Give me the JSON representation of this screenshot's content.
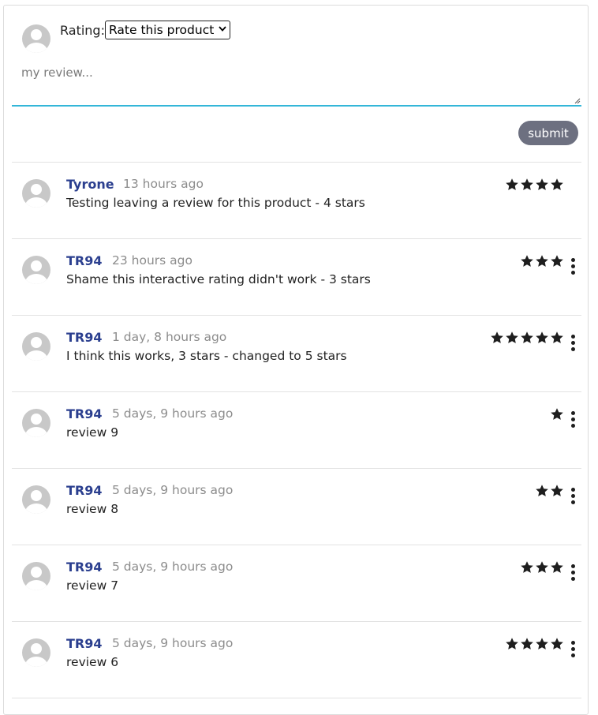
{
  "form": {
    "rating_label": "Rating:",
    "rating_select_value": "Rate this product",
    "review_placeholder": "my review...",
    "submit_label": "submit"
  },
  "colors": {
    "author": "#2b3f8f",
    "submit_bg": "#6d7080",
    "input_focus": "#33b6d8",
    "star": "#1e1e1e"
  },
  "reviews": [
    {
      "author": "Tyrone",
      "time": "13 hours ago",
      "text": "Testing leaving a review for this product - 4 stars",
      "stars": 4,
      "has_menu": false
    },
    {
      "author": "TR94",
      "time": "23 hours ago",
      "text": "Shame this interactive rating didn't work - 3 stars",
      "stars": 3,
      "has_menu": true
    },
    {
      "author": "TR94",
      "time": "1 day, 8 hours ago",
      "text": "I think this works, 3 stars - changed to 5 stars",
      "stars": 5,
      "has_menu": true
    },
    {
      "author": "TR94",
      "time": "5 days, 9 hours ago",
      "text": "review 9",
      "stars": 1,
      "has_menu": true
    },
    {
      "author": "TR94",
      "time": "5 days, 9 hours ago",
      "text": "review 8",
      "stars": 2,
      "has_menu": true
    },
    {
      "author": "TR94",
      "time": "5 days, 9 hours ago",
      "text": "review 7",
      "stars": 3,
      "has_menu": true
    },
    {
      "author": "TR94",
      "time": "5 days, 9 hours ago",
      "text": "review 6",
      "stars": 4,
      "has_menu": true
    }
  ]
}
